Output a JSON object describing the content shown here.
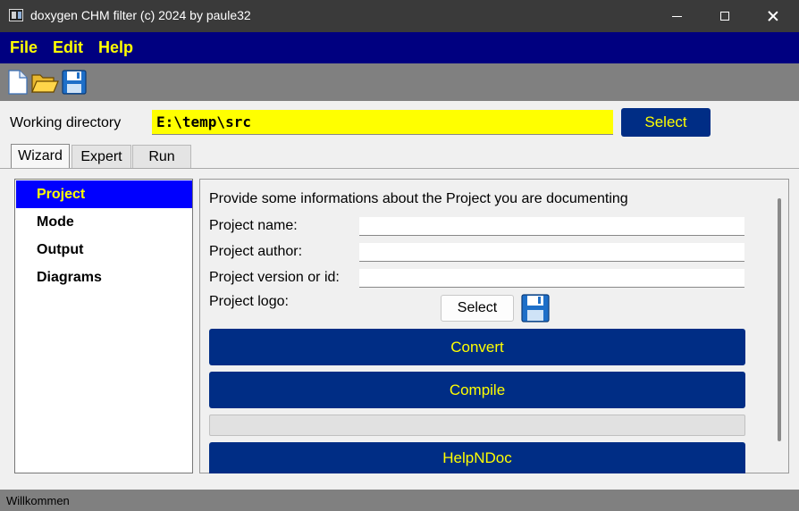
{
  "window": {
    "title": "doxygen CHM filter (c) 2024 by paule32"
  },
  "menu": {
    "items": [
      "File",
      "Edit",
      "Help"
    ]
  },
  "toolbar": {
    "icons": [
      "new-file-icon",
      "open-folder-icon",
      "save-icon"
    ]
  },
  "workdir": {
    "label": "Working directory",
    "value": "E:\\temp\\src",
    "select_label": "Select"
  },
  "tabs": [
    {
      "label": "Wizard",
      "active": true
    },
    {
      "label": "Expert",
      "active": false
    },
    {
      "label": "Run",
      "active": false
    }
  ],
  "nav": {
    "items": [
      {
        "label": "Project",
        "active": true
      },
      {
        "label": "Mode",
        "active": false
      },
      {
        "label": "Output",
        "active": false
      },
      {
        "label": "Diagrams",
        "active": false
      }
    ]
  },
  "project": {
    "info": "Provide some informations about the Project you are documenting",
    "name_label": "Project name:",
    "name_value": "",
    "author_label": "Project author:",
    "author_value": "",
    "version_label": "Project version or id:",
    "version_value": "",
    "logo_label": "Project logo:",
    "logo_select_label": "Select"
  },
  "actions": {
    "convert": "Convert",
    "compile": "Compile",
    "progress": 0,
    "helpndoc": "HelpNDoc"
  },
  "status": {
    "text": "Willkommen"
  },
  "colors": {
    "menubar": "#000080",
    "accent_yellow": "#ffff00",
    "button_blue": "#002d85",
    "nav_active": "#0000ff",
    "toolbar": "#808080"
  }
}
